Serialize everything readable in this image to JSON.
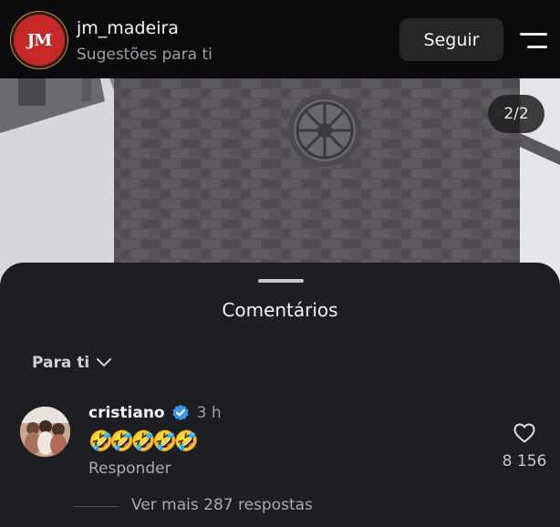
{
  "header": {
    "avatar_text": "JM",
    "username": "jm_madeira",
    "subtitle": "Sugestões para ti",
    "follow_label": "Seguir",
    "menu_icon": "hamburger-menu-icon"
  },
  "post": {
    "page_indicator": "2/2"
  },
  "comments": {
    "title": "Comentários",
    "filter_label": "Para ti",
    "filter_icon": "chevron-down-icon",
    "items": [
      {
        "username": "cristiano",
        "verified": true,
        "time": "3 h",
        "text": "🤣🤣🤣🤣🤣",
        "reply_label": "Responder",
        "like_count": "8 156",
        "more_replies": "Ver mais 287 respostas"
      }
    ]
  },
  "colors": {
    "verified_badge": "#3797f0",
    "avatar_brand": "#c62828",
    "sheet_background": "#1c1e22"
  }
}
